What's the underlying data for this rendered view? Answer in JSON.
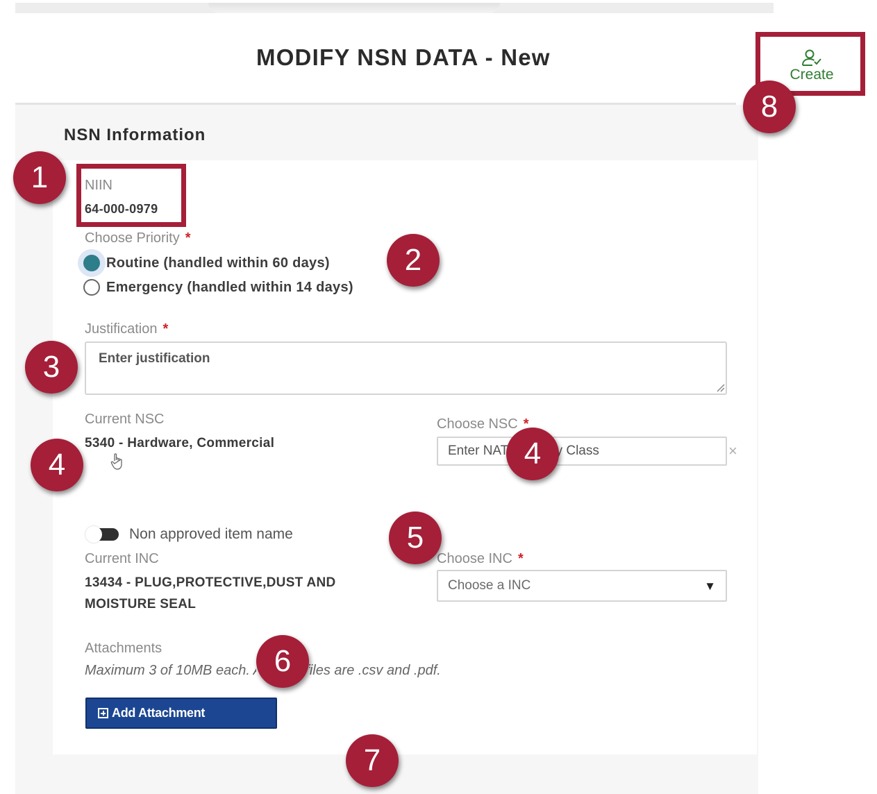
{
  "header": {
    "title": "MODIFY NSN DATA - New",
    "create_label": "Create"
  },
  "section": {
    "title": "NSN Information"
  },
  "niin": {
    "label": "NIIN",
    "value": "64-000-0979"
  },
  "priority": {
    "label": "Choose Priority",
    "required_mark": "*",
    "options": [
      {
        "label": "Routine (handled within 60 days)",
        "selected": true
      },
      {
        "label": "Emergency (handled within 14 days)",
        "selected": false
      }
    ]
  },
  "justification": {
    "label": "Justification",
    "required_mark": "*",
    "placeholder": "Enter justification"
  },
  "current_nsc": {
    "label": "Current NSC",
    "value": "5340 - Hardware, Commercial"
  },
  "choose_nsc": {
    "label": "Choose NSC",
    "required_mark": "*",
    "placeholder": "Enter NATO Supply Class",
    "clear_glyph": "×"
  },
  "non_approved": {
    "label": "Non approved item name",
    "enabled": false
  },
  "current_inc": {
    "label": "Current INC",
    "value_line1": "13434 - PLUG,PROTECTIVE,DUST AND",
    "value_line2": "MOISTURE SEAL"
  },
  "choose_inc": {
    "label": "Choose INC",
    "required_mark": "*",
    "placeholder": "Choose a INC",
    "arrow_glyph": "▼"
  },
  "attachments": {
    "label": "Attachments",
    "note": "Maximum 3 of 10MB each. Allowed files are .csv and .pdf.",
    "button_label": "Add Attachment"
  },
  "callouts": [
    "1",
    "2",
    "3",
    "4",
    "4",
    "5",
    "6",
    "7",
    "8"
  ],
  "colors": {
    "callout": "#a51f38",
    "create": "#2f7d32",
    "primary_button": "#1c4692",
    "required": "#d0202a",
    "radio_selected": "#2e7d8a"
  },
  "icons": {
    "create": "user-check-icon",
    "pointer": "hand-pointer-icon",
    "attachment": "plus-square-icon",
    "clear": "close-icon",
    "dropdown": "chevron-down-icon"
  }
}
